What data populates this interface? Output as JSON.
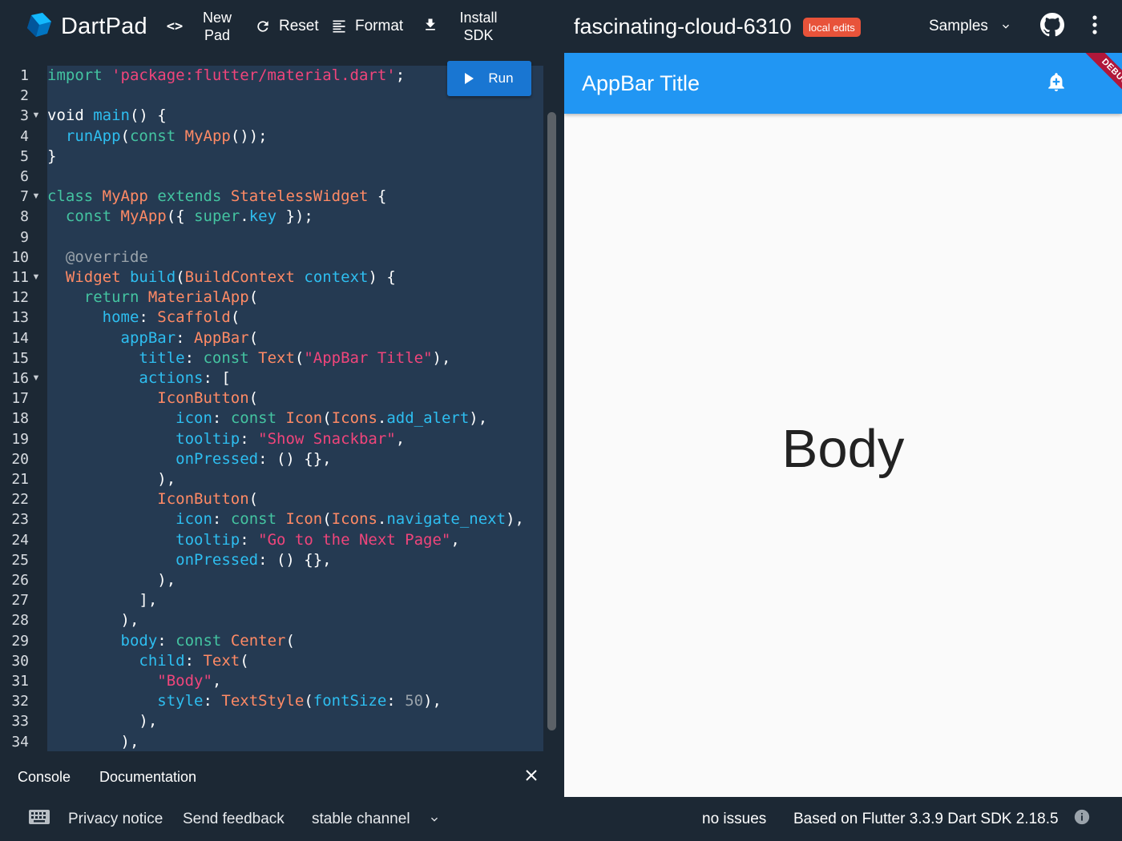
{
  "topbar": {
    "brand": "DartPad",
    "new_pad": [
      "New",
      "Pad"
    ],
    "reset": "Reset",
    "format": "Format",
    "install_sdk": [
      "Install",
      "SDK"
    ],
    "pad_title": "fascinating-cloud-6310",
    "badge": "local edits",
    "samples": "Samples",
    "icons": [
      "dart-logo-icon",
      "code-brackets-icon",
      "refresh-icon",
      "format-lines-icon",
      "download-icon",
      "chevron-down-icon",
      "github-icon",
      "more-vert-icon"
    ]
  },
  "editor": {
    "run_label": "Run",
    "folded_lines": [
      3,
      7,
      11,
      16
    ],
    "lines": [
      [
        [
          "kw",
          "import"
        ],
        [
          "pl",
          " "
        ],
        [
          "st",
          "'package:flutter/material.dart'"
        ],
        [
          "pl",
          ";"
        ]
      ],
      [],
      [
        [
          "pl",
          "void "
        ],
        [
          "fn",
          "main"
        ],
        [
          "pl",
          "() {"
        ]
      ],
      [
        [
          "pl",
          "  "
        ],
        [
          "fn",
          "runApp"
        ],
        [
          "pl",
          "("
        ],
        [
          "kw",
          "const"
        ],
        [
          "pl",
          " "
        ],
        [
          "ty",
          "MyApp"
        ],
        [
          "pl",
          "());"
        ]
      ],
      [
        [
          "pl",
          "}"
        ]
      ],
      [],
      [
        [
          "kw",
          "class"
        ],
        [
          "pl",
          " "
        ],
        [
          "ty",
          "MyApp"
        ],
        [
          "pl",
          " "
        ],
        [
          "kw",
          "extends"
        ],
        [
          "pl",
          " "
        ],
        [
          "ty",
          "StatelessWidget"
        ],
        [
          "pl",
          " {"
        ]
      ],
      [
        [
          "pl",
          "  "
        ],
        [
          "kw",
          "const"
        ],
        [
          "pl",
          " "
        ],
        [
          "ty",
          "MyApp"
        ],
        [
          "pl",
          "({ "
        ],
        [
          "kw",
          "super"
        ],
        [
          "pl",
          "."
        ],
        [
          "fn",
          "key"
        ],
        [
          "pl",
          " });"
        ]
      ],
      [],
      [
        [
          "pl",
          "  "
        ],
        [
          "cm",
          "@override"
        ]
      ],
      [
        [
          "pl",
          "  "
        ],
        [
          "ty",
          "Widget"
        ],
        [
          "pl",
          " "
        ],
        [
          "fn",
          "build"
        ],
        [
          "pl",
          "("
        ],
        [
          "ty",
          "BuildContext"
        ],
        [
          "pl",
          " "
        ],
        [
          "fn",
          "context"
        ],
        [
          "pl",
          ") {"
        ]
      ],
      [
        [
          "pl",
          "    "
        ],
        [
          "kw",
          "return"
        ],
        [
          "pl",
          " "
        ],
        [
          "ty",
          "MaterialApp"
        ],
        [
          "pl",
          "("
        ]
      ],
      [
        [
          "pl",
          "      "
        ],
        [
          "fn",
          "home"
        ],
        [
          "pl",
          ": "
        ],
        [
          "ty",
          "Scaffold"
        ],
        [
          "pl",
          "("
        ]
      ],
      [
        [
          "pl",
          "        "
        ],
        [
          "fn",
          "appBar"
        ],
        [
          "pl",
          ": "
        ],
        [
          "ty",
          "AppBar"
        ],
        [
          "pl",
          "("
        ]
      ],
      [
        [
          "pl",
          "          "
        ],
        [
          "fn",
          "title"
        ],
        [
          "pl",
          ": "
        ],
        [
          "kw",
          "const"
        ],
        [
          "pl",
          " "
        ],
        [
          "ty",
          "Text"
        ],
        [
          "pl",
          "("
        ],
        [
          "st",
          "\"AppBar Title\""
        ],
        [
          "pl",
          "),"
        ]
      ],
      [
        [
          "pl",
          "          "
        ],
        [
          "fn",
          "actions"
        ],
        [
          "pl",
          ": ["
        ]
      ],
      [
        [
          "pl",
          "            "
        ],
        [
          "ty",
          "IconButton"
        ],
        [
          "pl",
          "("
        ]
      ],
      [
        [
          "pl",
          "              "
        ],
        [
          "fn",
          "icon"
        ],
        [
          "pl",
          ": "
        ],
        [
          "kw",
          "const"
        ],
        [
          "pl",
          " "
        ],
        [
          "ty",
          "Icon"
        ],
        [
          "pl",
          "("
        ],
        [
          "ty",
          "Icons"
        ],
        [
          "pl",
          "."
        ],
        [
          "fn",
          "add_alert"
        ],
        [
          "pl",
          "),"
        ]
      ],
      [
        [
          "pl",
          "              "
        ],
        [
          "fn",
          "tooltip"
        ],
        [
          "pl",
          ": "
        ],
        [
          "st",
          "\"Show Snackbar\""
        ],
        [
          "pl",
          ","
        ]
      ],
      [
        [
          "pl",
          "              "
        ],
        [
          "fn",
          "onPressed"
        ],
        [
          "pl",
          ": () {},"
        ]
      ],
      [
        [
          "pl",
          "            ),"
        ]
      ],
      [
        [
          "pl",
          "            "
        ],
        [
          "ty",
          "IconButton"
        ],
        [
          "pl",
          "("
        ]
      ],
      [
        [
          "pl",
          "              "
        ],
        [
          "fn",
          "icon"
        ],
        [
          "pl",
          ": "
        ],
        [
          "kw",
          "const"
        ],
        [
          "pl",
          " "
        ],
        [
          "ty",
          "Icon"
        ],
        [
          "pl",
          "("
        ],
        [
          "ty",
          "Icons"
        ],
        [
          "pl",
          "."
        ],
        [
          "fn",
          "navigate_next"
        ],
        [
          "pl",
          "),"
        ]
      ],
      [
        [
          "pl",
          "              "
        ],
        [
          "fn",
          "tooltip"
        ],
        [
          "pl",
          ": "
        ],
        [
          "st",
          "\"Go to the Next Page\""
        ],
        [
          "pl",
          ","
        ]
      ],
      [
        [
          "pl",
          "              "
        ],
        [
          "fn",
          "onPressed"
        ],
        [
          "pl",
          ": () {},"
        ]
      ],
      [
        [
          "pl",
          "            ),"
        ]
      ],
      [
        [
          "pl",
          "          ],"
        ]
      ],
      [
        [
          "pl",
          "        ),"
        ]
      ],
      [
        [
          "pl",
          "        "
        ],
        [
          "fn",
          "body"
        ],
        [
          "pl",
          ": "
        ],
        [
          "kw",
          "const"
        ],
        [
          "pl",
          " "
        ],
        [
          "ty",
          "Center"
        ],
        [
          "pl",
          "("
        ]
      ],
      [
        [
          "pl",
          "          "
        ],
        [
          "fn",
          "child"
        ],
        [
          "pl",
          ": "
        ],
        [
          "ty",
          "Text"
        ],
        [
          "pl",
          "("
        ]
      ],
      [
        [
          "pl",
          "            "
        ],
        [
          "st",
          "\"Body\""
        ],
        [
          "pl",
          ","
        ]
      ],
      [
        [
          "pl",
          "            "
        ],
        [
          "fn",
          "style"
        ],
        [
          "pl",
          ": "
        ],
        [
          "ty",
          "TextStyle"
        ],
        [
          "pl",
          "("
        ],
        [
          "fn",
          "fontSize"
        ],
        [
          "pl",
          ": "
        ],
        [
          "nu",
          "50"
        ],
        [
          "pl",
          "),"
        ]
      ],
      [
        [
          "pl",
          "          ),"
        ]
      ],
      [
        [
          "pl",
          "        ),"
        ]
      ]
    ]
  },
  "console_bar": {
    "console": "Console",
    "documentation": "Documentation",
    "close_icon": "close-icon"
  },
  "preview": {
    "appbar_title": "AppBar Title",
    "action_icon": "add-alert-icon",
    "debug_banner": "DEBUG",
    "body_text": "Body",
    "colors": {
      "appbar": "#2196f3",
      "banner": "#b0173a",
      "background": "#fafafa"
    }
  },
  "footer": {
    "keyboard_icon": "keyboard-icon",
    "privacy": "Privacy notice",
    "feedback": "Send feedback",
    "channel": "stable channel",
    "issues": "no issues",
    "sdk": "Based on Flutter 3.3.9 Dart SDK 2.18.5",
    "info_icon": "info-icon"
  },
  "colors": {
    "chrome": "#1c2834",
    "editor_bg": "#253a52",
    "run_button": "#1976d2",
    "badge": "#e8533a"
  }
}
